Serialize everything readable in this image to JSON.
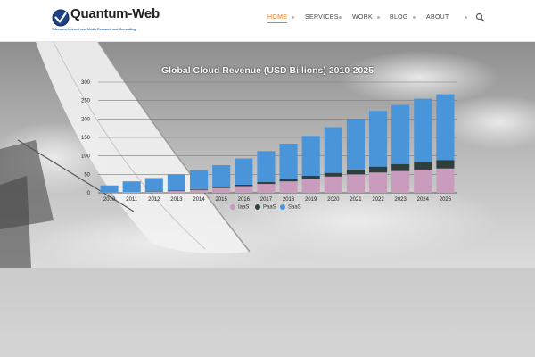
{
  "brand": {
    "name": "Quantum-Web",
    "tagline": "Telecoms, Internet and Media Research and Consulting",
    "accent_color": "#e37b22",
    "logo_icon": "globe-check-icon"
  },
  "nav": {
    "items": [
      {
        "label": "HOME",
        "active": true
      },
      {
        "label": "SERVICES",
        "active": false
      },
      {
        "label": "WORK",
        "active": false
      },
      {
        "label": "BLOG",
        "active": false
      },
      {
        "label": "ABOUT",
        "active": false
      }
    ],
    "search_icon": "search-icon"
  },
  "hero": {
    "slides_count": 13,
    "active_slide": 1
  },
  "chart_data": {
    "type": "bar",
    "stacked": true,
    "title": "Global Cloud Revenue (USD Billions) 2010-2025",
    "xlabel": "",
    "ylabel": "",
    "ylim": [
      0,
      300
    ],
    "yticks": [
      "0",
      "50",
      "100",
      "150",
      "200",
      "250",
      "300"
    ],
    "grid": true,
    "legend_position": "bottom",
    "categories": [
      "2010",
      "2011",
      "2012",
      "2013",
      "2014",
      "2015",
      "2016",
      "2017",
      "2018",
      "2019",
      "2020",
      "2021",
      "2022",
      "2023",
      "2024",
      "2025"
    ],
    "series": [
      {
        "name": "IaaS",
        "color": "#c99bbd",
        "values": [
          1,
          2,
          3,
          5,
          8,
          13,
          18,
          24,
          31,
          38,
          44,
          50,
          55,
          59,
          63,
          66
        ]
      },
      {
        "name": "PaaS",
        "color": "#2f3f3e",
        "values": [
          0,
          0,
          1,
          1,
          2,
          3,
          4,
          5,
          6,
          8,
          10,
          13,
          16,
          19,
          21,
          23
        ]
      },
      {
        "name": "SaaS",
        "color": "#4a94d9",
        "values": [
          19,
          29,
          36,
          43,
          51,
          59,
          71,
          84,
          96,
          108,
          124,
          137,
          151,
          160,
          171,
          178
        ]
      }
    ]
  }
}
